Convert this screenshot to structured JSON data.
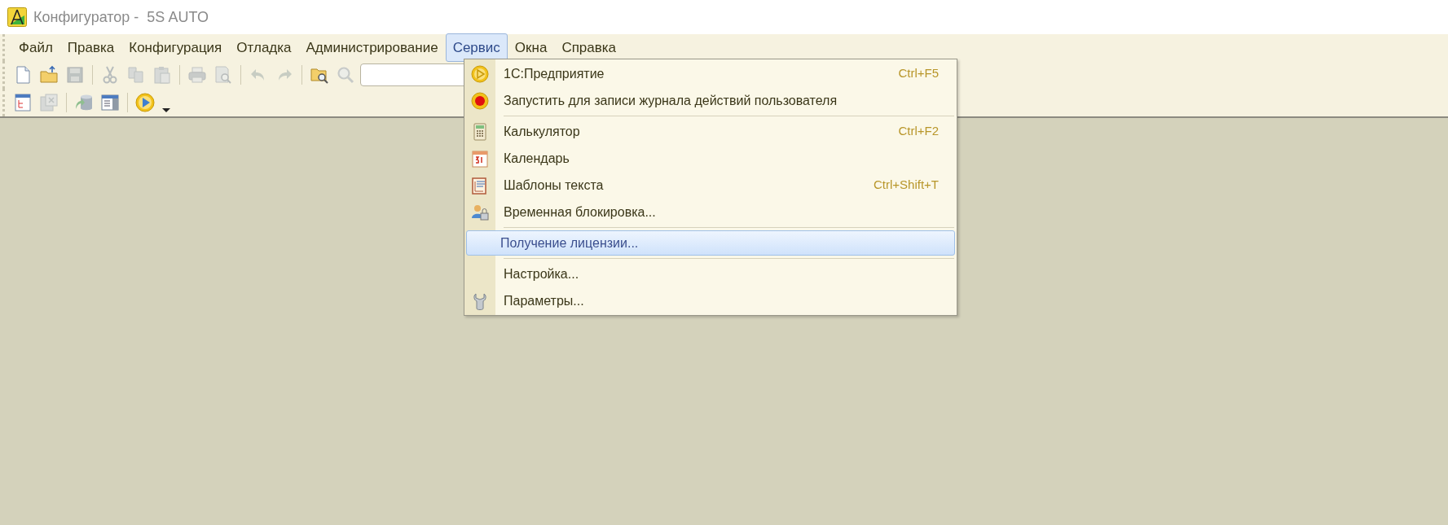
{
  "window": {
    "title": "Конфигуратор -  5S AUTO"
  },
  "menu_bar": [
    {
      "label": "Файл",
      "selected": false
    },
    {
      "label": "Правка",
      "selected": false
    },
    {
      "label": "Конфигурация",
      "selected": false
    },
    {
      "label": "Отладка",
      "selected": false
    },
    {
      "label": "Администрирование",
      "selected": false
    },
    {
      "label": "Сервис",
      "selected": true
    },
    {
      "label": "Окна",
      "selected": false
    },
    {
      "label": "Справка",
      "selected": false
    }
  ],
  "toolbar_1": [
    {
      "kind": "new",
      "disabled": false
    },
    {
      "kind": "open",
      "disabled": false
    },
    {
      "kind": "save",
      "disabled": true
    },
    {
      "kind": "separator"
    },
    {
      "kind": "cut",
      "disabled": true
    },
    {
      "kind": "copy",
      "disabled": true
    },
    {
      "kind": "paste",
      "disabled": true
    },
    {
      "kind": "separator"
    },
    {
      "kind": "print",
      "disabled": true
    },
    {
      "kind": "preview",
      "disabled": true
    },
    {
      "kind": "separator"
    },
    {
      "kind": "undo",
      "disabled": true
    },
    {
      "kind": "redo",
      "disabled": true
    },
    {
      "kind": "separator"
    },
    {
      "kind": "find",
      "disabled": false
    },
    {
      "kind": "search",
      "disabled": true
    },
    {
      "kind": "field"
    }
  ],
  "toolbar_2": [
    {
      "kind": "tree",
      "disabled": false
    },
    {
      "kind": "compare",
      "disabled": true
    },
    {
      "kind": "separator"
    },
    {
      "kind": "database",
      "disabled": false
    },
    {
      "kind": "table",
      "disabled": false
    },
    {
      "kind": "separator"
    },
    {
      "kind": "run",
      "disabled": false
    },
    {
      "kind": "dropdown",
      "disabled": false
    }
  ],
  "service_menu": [
    {
      "kind": "item",
      "label": "1С:Предприятие",
      "shortcut": "Ctrl+F5",
      "selected": false
    },
    {
      "kind": "item",
      "label": "Запустить для записи журнала действий пользователя",
      "selected": false
    },
    {
      "kind": "separator"
    },
    {
      "kind": "item",
      "label": "Калькулятор",
      "shortcut": "Ctrl+F2",
      "selected": false
    },
    {
      "kind": "item",
      "label": "Календарь",
      "selected": false
    },
    {
      "kind": "item",
      "label": "Шаблоны текста",
      "shortcut": "Ctrl+Shift+T",
      "selected": false
    },
    {
      "kind": "item",
      "label": "Временная блокировка...",
      "selected": false
    },
    {
      "kind": "separator"
    },
    {
      "kind": "item",
      "label": "Получение лицензии...",
      "selected": true
    },
    {
      "kind": "separator"
    },
    {
      "kind": "item",
      "label": "Настройка...",
      "selected": false
    },
    {
      "kind": "item",
      "label": "Параметры...",
      "selected": false
    }
  ]
}
